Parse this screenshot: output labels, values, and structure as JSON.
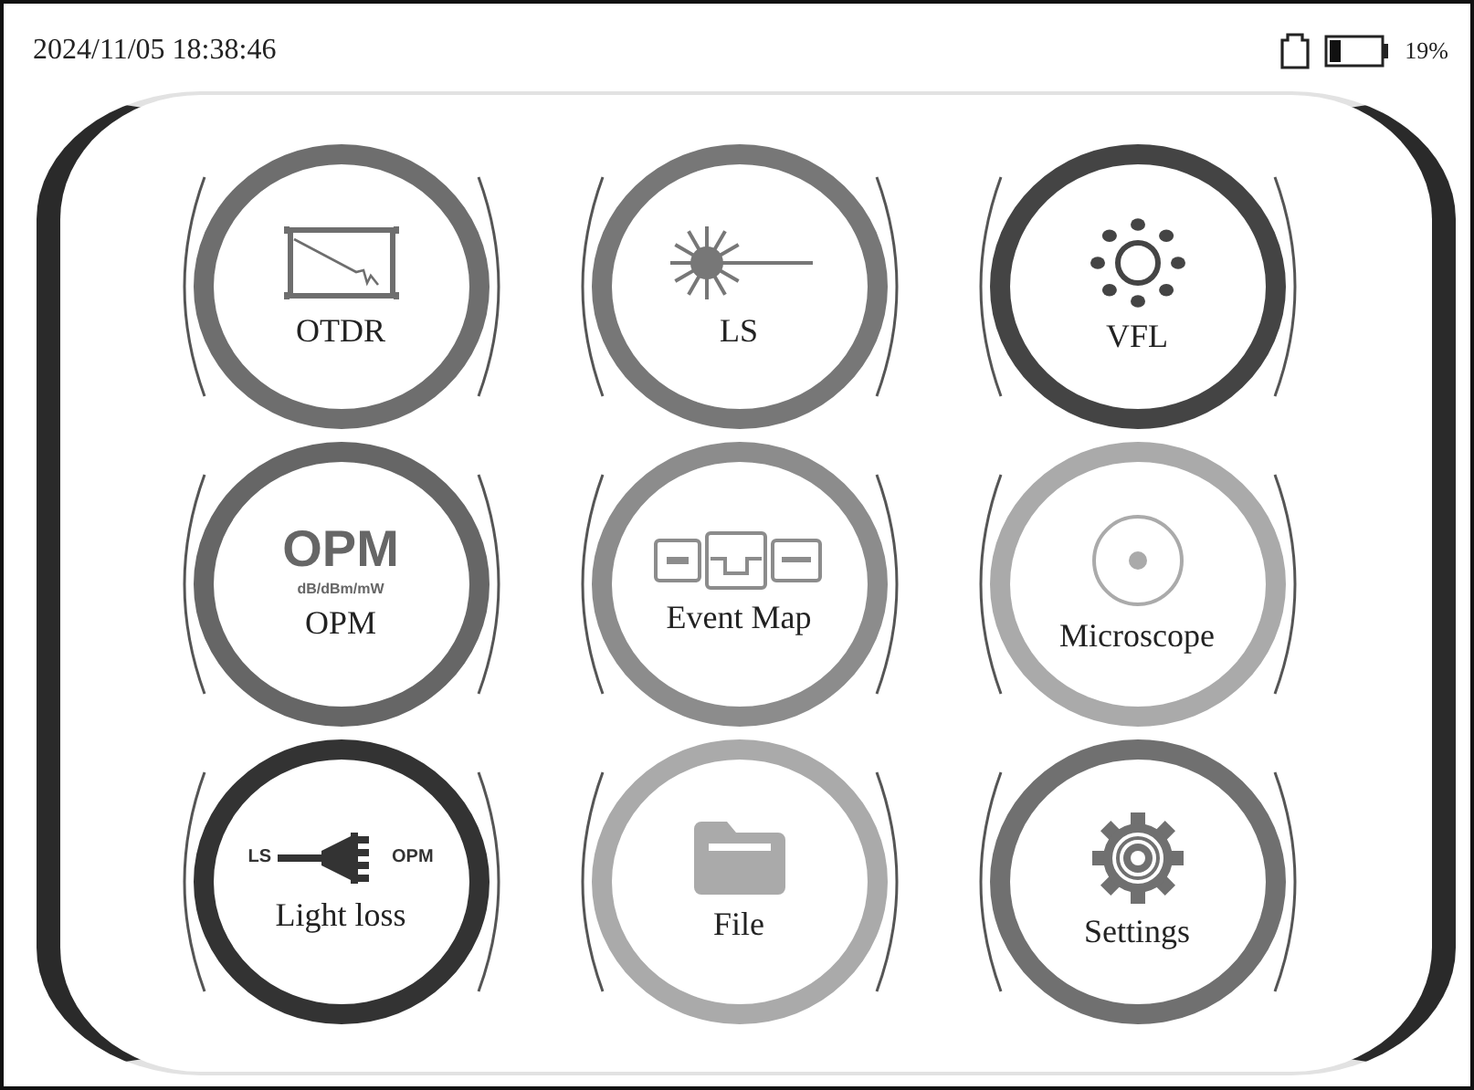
{
  "status_bar": {
    "datetime": "2024/11/05 18:38:46",
    "battery": "19%"
  },
  "tiles": [
    {
      "label": "OTDR",
      "kind": "otdr",
      "color": "#6e6e6e"
    },
    {
      "label": "LS",
      "kind": "laser",
      "color": "#777777"
    },
    {
      "label": "VFL",
      "kind": "sun",
      "color": "#444444"
    },
    {
      "label": "OPM",
      "kind": "opm",
      "color": "#666666",
      "icon_text": [
        "OPM",
        "dB/dBm/mW"
      ]
    },
    {
      "label": "Event Map",
      "kind": "event-map",
      "color": "#8c8c8c"
    },
    {
      "label": "Microscope",
      "kind": "target",
      "color": "#aaaaaa"
    },
    {
      "label": "Light loss",
      "kind": "cable",
      "color": "#333333",
      "icon_text": [
        "LS",
        "OPM"
      ]
    },
    {
      "label": "File",
      "kind": "folder",
      "color": "#aaaaaa"
    },
    {
      "label": "Settings",
      "kind": "gear",
      "color": "#707070"
    }
  ]
}
